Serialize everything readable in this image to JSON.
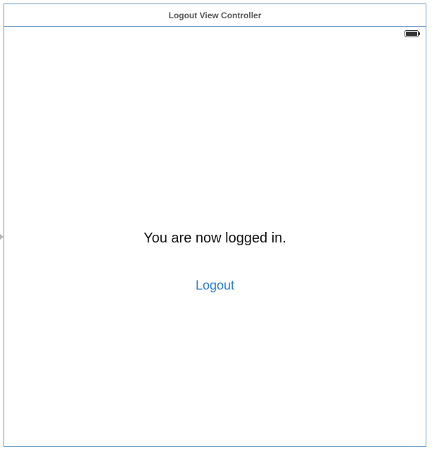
{
  "scene": {
    "title": "Logout View Controller"
  },
  "status_bar": {
    "battery_icon": "battery-icon"
  },
  "content": {
    "message": "You are now logged in.",
    "logout_label": "Logout"
  },
  "colors": {
    "accent": "#2a7fd4",
    "frame_border": "#6b9ac9",
    "title_text": "#555555",
    "body_text": "#111111"
  }
}
